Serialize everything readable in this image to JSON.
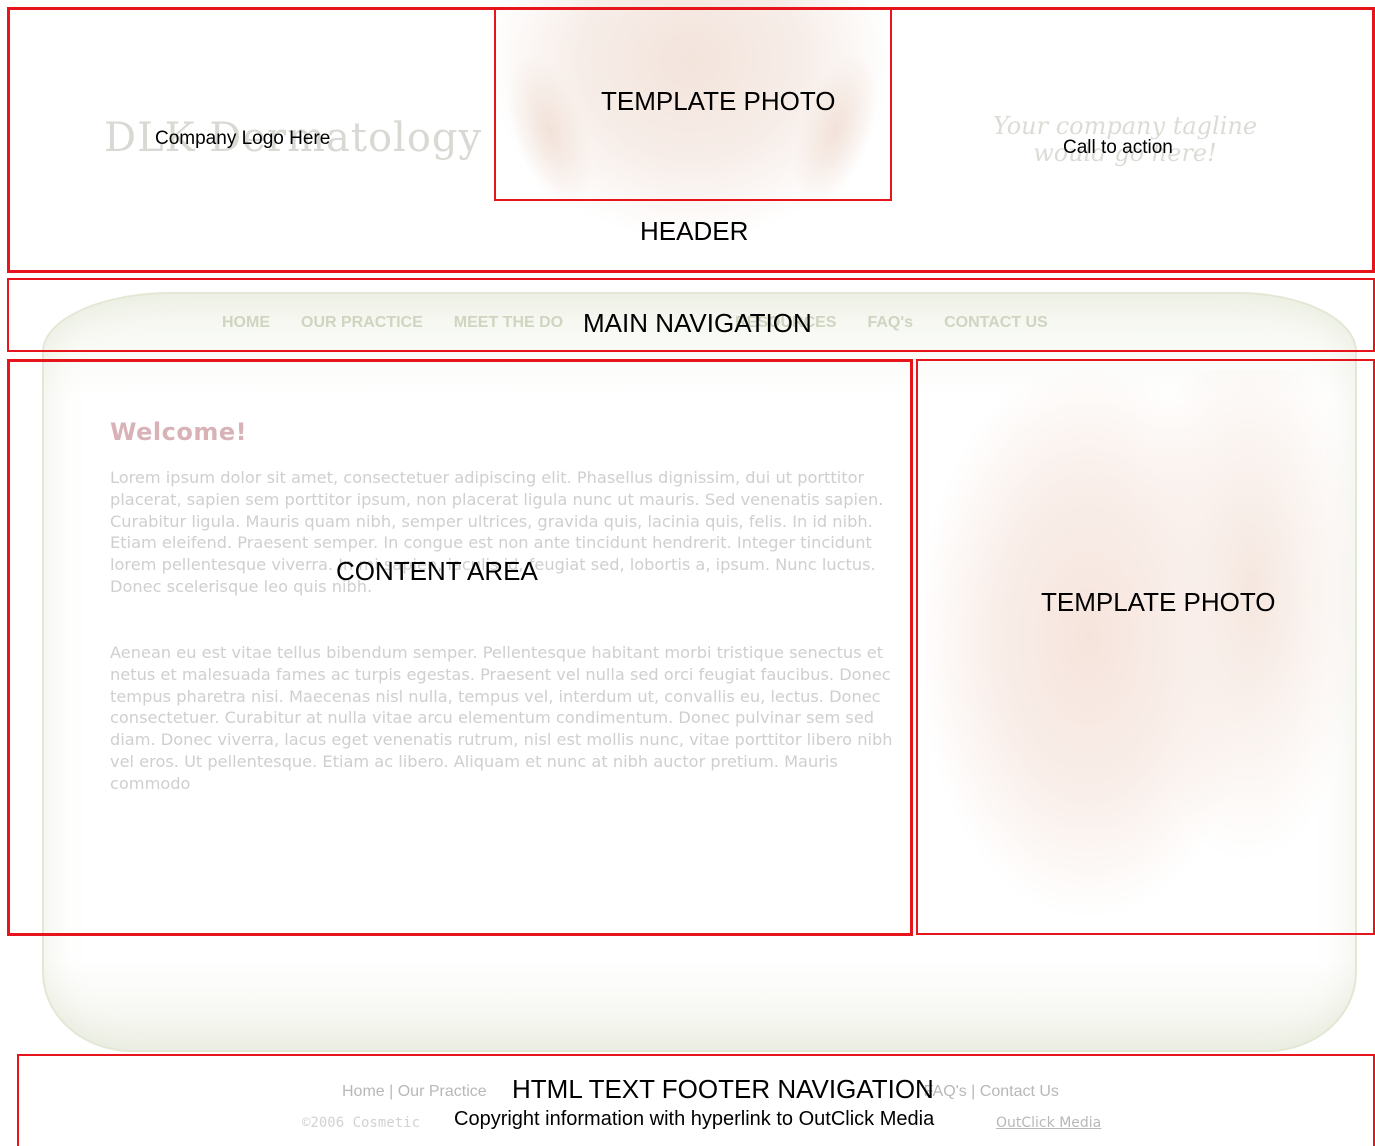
{
  "header": {
    "logo_text_faded": "DLK Dermatology",
    "logo_placeholder": "Company Logo Here",
    "tagline_line1": "Your company tagline",
    "tagline_line2": "would go here!",
    "cta_placeholder": "Call to action",
    "top_photo_label": "TEMPLATE PHOTO",
    "section_label": "HEADER"
  },
  "navigation": {
    "items": [
      "HOME",
      "OUR PRACTICE",
      "MEET THE DO",
      "RESOURCES",
      "FAQ's",
      "CONTACT US"
    ],
    "section_label": "MAIN NAVIGATION"
  },
  "content": {
    "heading": "Welcome!",
    "paragraph1": "Lorem ipsum dolor sit amet, consectetuer adipiscing elit. Phasellus dignissim, dui ut porttitor placerat, sapien sem porttitor ipsum, non placerat ligula nunc ut mauris. Sed venenatis sapien. Curabitur ligula. Mauris quam nibh, semper ultrices, gravida quis, lacinia quis, felis. In id nibh. Etiam eleifend. Praesent semper. In congue est non ante tincidunt hendrerit. Integer tincidunt lorem pellentesque viverra. In mi sapien, iaculis id, feugiat sed, lobortis a, ipsum. Nunc luctus. Donec scelerisque leo quis nibh.",
    "paragraph2": "Aenean eu est vitae tellus bibendum semper. Pellentesque habitant morbi tristique senectus et netus et malesuada fames ac turpis egestas. Praesent vel nulla sed orci feugiat faucibus. Donec tempus pharetra nisi. Maecenas nisl nulla, tempus vel, interdum ut, convallis eu, lectus. Donec consectetuer. Curabitur at nulla vitae arcu elementum condimentum. Donec pulvinar sem sed diam. Donec viverra, lacus eget venenatis rutrum, nisl est mollis nunc, vitae porttitor libero nibh vel eros. Ut pellentesque. Etiam ac libero. Aliquam et nunc at nibh auctor pretium. Mauris commodo",
    "section_label": "CONTENT AREA",
    "side_photo_label": "TEMPLATE PHOTO"
  },
  "footer": {
    "links": [
      "Home",
      "Our Practice",
      "FAQ's",
      "Contact Us"
    ],
    "separator": " | ",
    "copyright_faded": "©2006 Cosmetic",
    "copyright_link": "OutClick Media",
    "nav_label": "HTML TEXT FOOTER NAVIGATION",
    "copyright_label": "Copyright information with hyperlink to OutClick Media"
  },
  "colors": {
    "annotation_red": "#e8141b",
    "welcome_pink": "#d8b2b6",
    "nav_green_gray": "#cfd5c1"
  }
}
